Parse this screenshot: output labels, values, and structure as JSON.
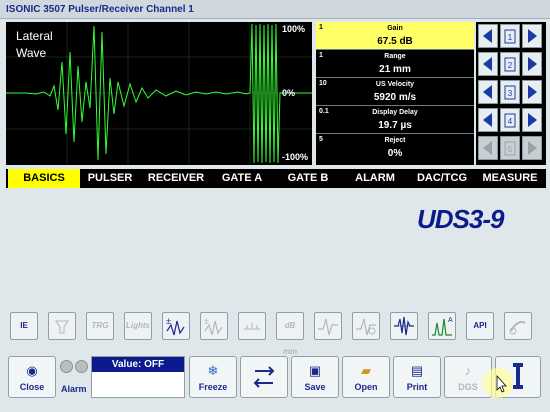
{
  "window": {
    "title": "ISONIC 3507 Pulser/Receiver Channel 1"
  },
  "scope": {
    "annotation_line1": "Lateral",
    "annotation_line2": "Wave",
    "scale_top": "100%",
    "scale_mid": "0%",
    "scale_bottom": "-100%"
  },
  "params": [
    {
      "index": "1",
      "label": "Gain",
      "value": "67.5 dB",
      "selected": true
    },
    {
      "index": "1",
      "label": "Range",
      "value": "21 mm",
      "selected": false
    },
    {
      "index": "10",
      "label": "US Velocity",
      "value": "5920 m/s",
      "selected": false
    },
    {
      "index": "0.1",
      "label": "Display Delay",
      "value": "19.7 µs",
      "selected": false
    },
    {
      "index": "5",
      "label": "Reject",
      "value": "0%",
      "selected": false
    }
  ],
  "param_controls": [
    {
      "step_label": "1",
      "enabled": true
    },
    {
      "step_label": "2",
      "enabled": true
    },
    {
      "step_label": "3",
      "enabled": true
    },
    {
      "step_label": "4",
      "enabled": true
    },
    {
      "step_label": "5",
      "enabled": false
    }
  ],
  "menu": {
    "items": [
      "BASICS",
      "PULSER",
      "RECEIVER",
      "GATE A",
      "GATE B",
      "ALARM",
      "DAC/TCG",
      "MEASURE"
    ],
    "selected": "BASICS"
  },
  "brand": {
    "logo_text": "UDS3-9"
  },
  "toolbar": {
    "items": [
      {
        "label": "IE",
        "icon": "ie-icon",
        "enabled": true
      },
      {
        "label": "",
        "icon": "fill-icon",
        "enabled": false
      },
      {
        "label": "TRG",
        "icon": "trg-icon",
        "enabled": false
      },
      {
        "label": "Lights",
        "icon": "lights-icon",
        "enabled": false
      },
      {
        "label": "",
        "icon": "gain-a-icon",
        "enabled": true
      },
      {
        "label": "",
        "icon": "gain-b-icon",
        "enabled": false
      },
      {
        "label": "",
        "icon": "ruler-icon",
        "enabled": false
      },
      {
        "label": "dB mm",
        "icon": "db-mm-icon",
        "enabled": false
      },
      {
        "label": "",
        "icon": "peak-icon",
        "enabled": false
      },
      {
        "label": "",
        "icon": "peak-memory-icon",
        "enabled": false
      },
      {
        "label": "",
        "icon": "rf-waveform-icon",
        "enabled": true
      },
      {
        "label": "",
        "icon": "a-scan-icon",
        "enabled": true
      },
      {
        "label": "API",
        "icon": "api-icon",
        "enabled": true
      },
      {
        "label": "",
        "icon": "probe-icon",
        "enabled": false
      }
    ]
  },
  "bottom": {
    "close_label": "Close",
    "alarm_label": "Alarm",
    "value_text": "Value: OFF",
    "freeze_label": "Freeze",
    "save_label": "Save",
    "open_label": "Open",
    "print_label": "Print",
    "dgs_label": "DGS"
  },
  "colors": {
    "background": "#dfe7ea",
    "scope_bg": "#000000",
    "waveform": "#33ff33",
    "selected_param": "#ffff66",
    "selected_menu": "#ffff00",
    "accent": "#0b1a8c"
  }
}
